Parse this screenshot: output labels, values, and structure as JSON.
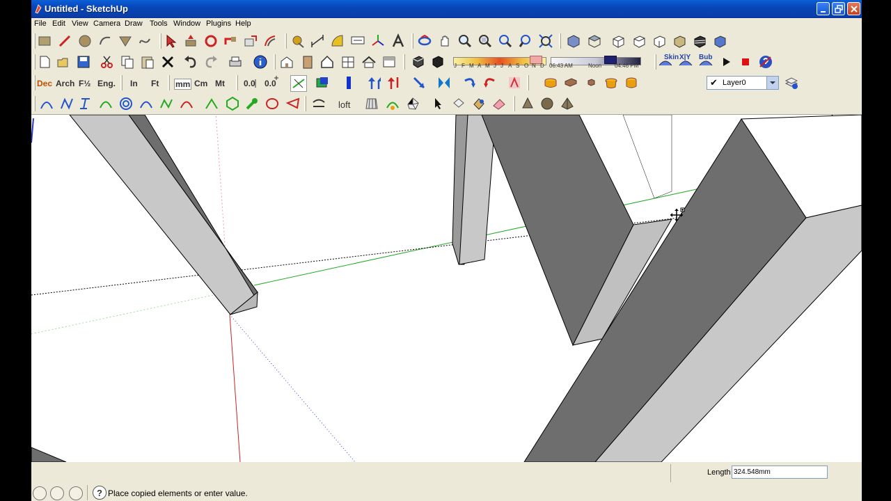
{
  "window": {
    "title": "Untitled - SketchUp"
  },
  "menus": [
    "File",
    "Edit",
    "View",
    "Camera",
    "Draw",
    "Tools",
    "Window",
    "Plugins",
    "Help"
  ],
  "toolbar_text": {
    "units": [
      "Dec",
      "Arch",
      "F½",
      "Eng.",
      "In",
      "Ft",
      "mm",
      "Cm",
      "Mt"
    ],
    "loft": "loft",
    "skin": "Skin",
    "xyz": "X|Y",
    "bub": "Bub"
  },
  "shadows": {
    "months": [
      "J",
      "F",
      "M",
      "A",
      "M",
      "J",
      "J",
      "A",
      "S",
      "O",
      "N",
      "D"
    ],
    "time_start": "06:43 AM",
    "time_mid": "Noon",
    "time_end": "04:46 PM"
  },
  "layers": {
    "current": "Layer0"
  },
  "status": {
    "message": "Place copied elements or enter value.",
    "vcb_label": "Length",
    "vcb_value": "324.548mm"
  },
  "colors": {
    "titlebar": "#0a5fd8",
    "chrome": "#ece9d8",
    "face_light": "#c8c8c8",
    "face_dark": "#6e6e6e",
    "axis_red": "#cc2222",
    "axis_green": "#22aa22"
  }
}
